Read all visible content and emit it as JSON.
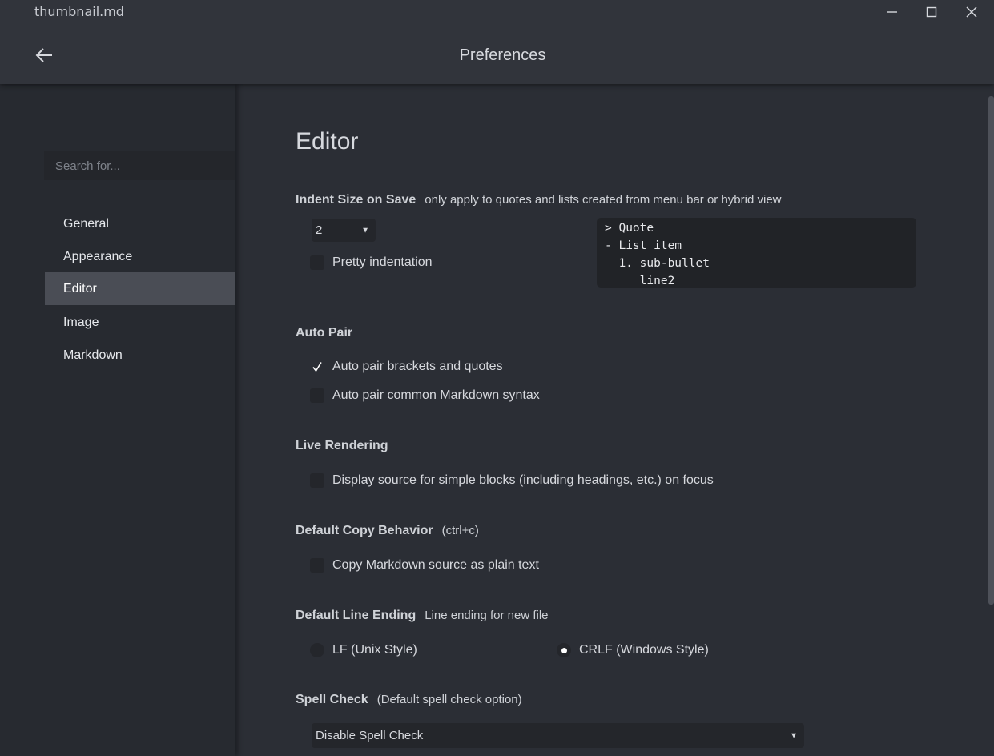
{
  "window": {
    "filename": "thumbnail.md",
    "controls": {
      "minimize": "—",
      "maximize": "☐",
      "close": "✕"
    }
  },
  "header": {
    "title": "Preferences",
    "back_icon": "arrow-left-icon"
  },
  "sidebar": {
    "search_placeholder": "Search for...",
    "items": [
      {
        "label": "General",
        "active": false
      },
      {
        "label": "Appearance",
        "active": false
      },
      {
        "label": "Editor",
        "active": true
      },
      {
        "label": "Image",
        "active": false
      },
      {
        "label": "Markdown",
        "active": false
      }
    ]
  },
  "main": {
    "heading": "Editor",
    "indent": {
      "title": "Indent Size on Save",
      "hint": "only apply to quotes and lists created from menu bar or hybrid view",
      "value": "2",
      "pretty_label": "Pretty indentation",
      "pretty_checked": false,
      "preview_lines": [
        "> Quote",
        "- List item",
        "  1. sub-bullet",
        "     line2"
      ]
    },
    "auto_pair": {
      "title": "Auto Pair",
      "brackets_label": "Auto pair brackets and quotes",
      "brackets_checked": true,
      "markdown_label": "Auto pair common Markdown syntax",
      "markdown_checked": false
    },
    "live_rendering": {
      "title": "Live Rendering",
      "source_label": "Display source for simple blocks (including headings, etc.) on focus",
      "source_checked": false
    },
    "copy_behavior": {
      "title": "Default Copy Behavior",
      "hint": "(ctrl+c)",
      "plain_label": "Copy Markdown source as plain text",
      "plain_checked": false
    },
    "line_ending": {
      "title": "Default Line Ending",
      "hint": "Line ending for new file",
      "lf_label": "LF (Unix Style)",
      "crlf_label": "CRLF (Windows Style)",
      "selected": "CRLF"
    },
    "spell_check": {
      "title": "Spell Check",
      "hint": "(Default spell check option)",
      "value": "Disable Spell Check"
    }
  },
  "colors": {
    "background": "#2b2e35",
    "sidebar": "#272a30",
    "titlebar": "#31343b",
    "active_item": "#4a4d55",
    "input": "#24262b"
  }
}
